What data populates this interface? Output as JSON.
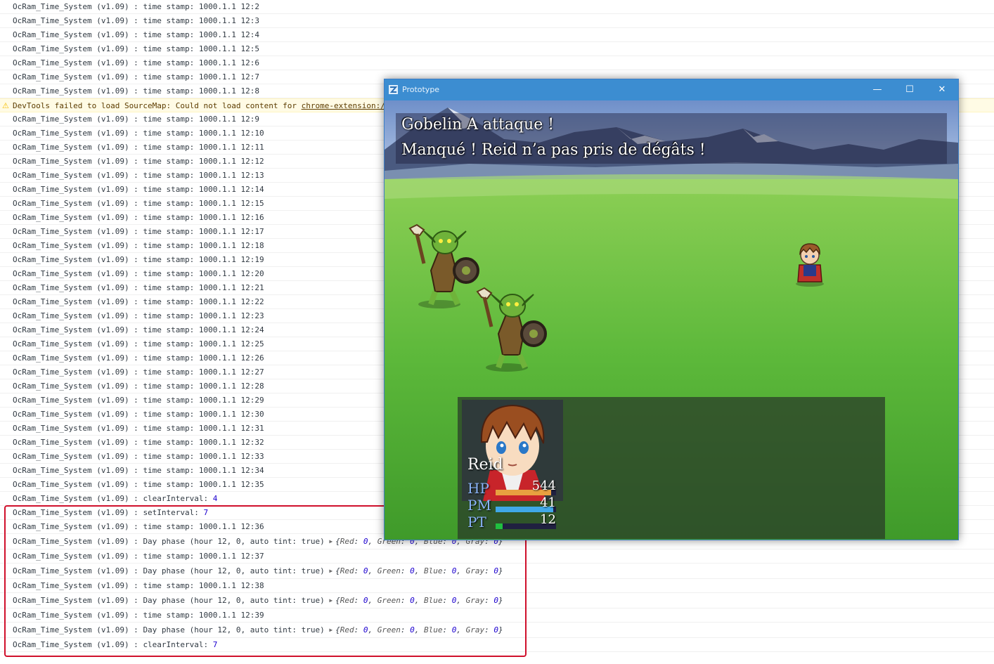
{
  "console": {
    "prefix": "OcRam_Time_System (v1.09) : ",
    "timestamp_label": "time stamp: ",
    "timestamps_before_warning": [
      "1000.1.1 12:2",
      "1000.1.1 12:3",
      "1000.1.1 12:4",
      "1000.1.1 12:5",
      "1000.1.1 12:6",
      "1000.1.1 12:7",
      "1000.1.1 12:8"
    ],
    "warning": {
      "text": "DevTools failed to load SourceMap: Could not load content for ",
      "link": "chrome-extension:/"
    },
    "timestamps_after_warning": [
      "1000.1.1 12:9",
      "1000.1.1 12:10",
      "1000.1.1 12:11",
      "1000.1.1 12:12",
      "1000.1.1 12:13",
      "1000.1.1 12:14",
      "1000.1.1 12:15",
      "1000.1.1 12:16",
      "1000.1.1 12:17",
      "1000.1.1 12:18",
      "1000.1.1 12:19",
      "1000.1.1 12:20",
      "1000.1.1 12:21",
      "1000.1.1 12:22",
      "1000.1.1 12:23",
      "1000.1.1 12:24",
      "1000.1.1 12:25",
      "1000.1.1 12:26",
      "1000.1.1 12:27",
      "1000.1.1 12:28",
      "1000.1.1 12:29",
      "1000.1.1 12:30",
      "1000.1.1 12:31",
      "1000.1.1 12:32",
      "1000.1.1 12:33",
      "1000.1.1 12:34",
      "1000.1.1 12:35"
    ],
    "clear_interval_1": {
      "label": "clearInterval: ",
      "value": "4"
    },
    "set_interval": {
      "label": "setInterval: ",
      "value": "7"
    },
    "highlighted": [
      {
        "kind": "stamp",
        "text": "1000.1.1 12:36"
      },
      {
        "kind": "phase",
        "text": "Day phase (hour 12, 0, auto tint: true) "
      },
      {
        "kind": "stamp",
        "text": "1000.1.1 12:37"
      },
      {
        "kind": "phase",
        "text": "Day phase (hour 12, 0, auto tint: true) "
      },
      {
        "kind": "stamp",
        "text": "1000.1.1 12:38"
      },
      {
        "kind": "phase",
        "text": "Day phase (hour 12, 0, auto tint: true) "
      },
      {
        "kind": "stamp",
        "text": "1000.1.1 12:39"
      },
      {
        "kind": "phase",
        "text": "Day phase (hour 12, 0, auto tint: true) "
      }
    ],
    "tint_object": {
      "red_key": "Red",
      "red": "0",
      "green_key": "Green",
      "green": "0",
      "blue_key": "Blue",
      "blue": "0",
      "gray_key": "Gray",
      "gray": "0"
    },
    "clear_interval_2": {
      "label": "clearInterval: ",
      "value": "7"
    },
    "colors": {
      "number": "#1c00cf",
      "warning_bg": "#fffbe5",
      "highlight_border": "#d0102c"
    }
  },
  "game_window": {
    "title": "Prototype",
    "minimize": "—",
    "maximize": "☐",
    "close": "✕",
    "message_line1": "Gobelin A attaque !",
    "message_line2": "Manqué ! Reid n’a pas pris de dégâts !",
    "actor": {
      "name": "Reid",
      "hp_label": "HP",
      "hp_value": "544",
      "hp_rate": 0.92,
      "mp_label": "PM",
      "mp_value": "41",
      "mp_rate": 0.95,
      "tp_label": "PT",
      "tp_value": "12",
      "tp_rate": 0.12
    },
    "colors": {
      "titlebar": "#3c8dd1",
      "hp_gauge": "#e8a040",
      "mp_gauge": "#40a8e8",
      "tp_gauge": "#20c040"
    }
  }
}
